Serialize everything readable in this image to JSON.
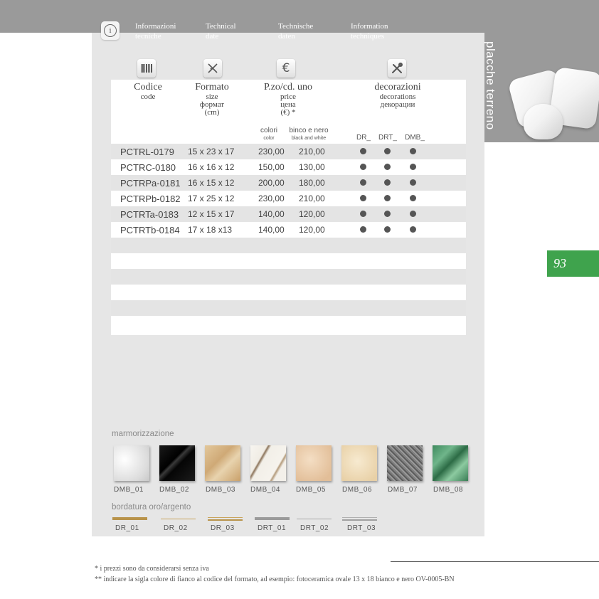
{
  "header": {
    "languages": [
      {
        "line1": "Informazioni",
        "line2": "tecniche"
      },
      {
        "line1": "Technical",
        "line2": "date"
      },
      {
        "line1": "Technische",
        "line2": "daten"
      },
      {
        "line1": "Information",
        "line2": "techniques"
      }
    ],
    "vertical_title": "placche terreno",
    "page_number": "93"
  },
  "icons": {
    "info": "info-icon",
    "barcode": "barcode-icon",
    "ruler": "ruler-pencil-icon",
    "euro": "euro-icon",
    "tools": "tools-icon"
  },
  "table": {
    "headers": {
      "code": {
        "main": "Codice",
        "sub": "code"
      },
      "size": {
        "main": "Formato",
        "sub": "size\nформат\n(cm)"
      },
      "price": {
        "main": "P.zo/cd. uno",
        "sub": "price\nцена\n(€) *"
      },
      "decorations": {
        "main": "decorazioni",
        "sub": "decorations\nдекорации"
      }
    },
    "subheaders": {
      "color": "colori",
      "color_en": "color",
      "bw": "binco e nero",
      "bw_en": "black and white",
      "dr": "DR_",
      "drt": "DRT_",
      "dmb": "DMB_"
    },
    "rows": [
      {
        "code": "PCTRL-0179",
        "size": "15 x 23 x 17",
        "color_price": "230,00",
        "bw_price": "210,00",
        "dr": true,
        "drt": true,
        "dmb": true
      },
      {
        "code": "PCTRC-0180",
        "size": "16 x 16 x 12",
        "color_price": "150,00",
        "bw_price": "130,00",
        "dr": true,
        "drt": true,
        "dmb": true
      },
      {
        "code": "PCTRPa-0181",
        "size": "16 x 15 x 12",
        "color_price": "200,00",
        "bw_price": "180,00",
        "dr": true,
        "drt": true,
        "dmb": true
      },
      {
        "code": "PCTRPb-0182",
        "size": "17 x 25 x 12",
        "color_price": "230,00",
        "bw_price": "210,00",
        "dr": true,
        "drt": true,
        "dmb": true
      },
      {
        "code": "PCTRTa-0183",
        "size": "12 x 15 x 17",
        "color_price": "140,00",
        "bw_price": "120,00",
        "dr": true,
        "drt": true,
        "dmb": true
      },
      {
        "code": "PCTRTb-0184",
        "size": "17 x 18 x13",
        "color_price": "140,00",
        "bw_price": "120,00",
        "dr": true,
        "drt": true,
        "dmb": true
      }
    ]
  },
  "marble": {
    "label": "marmorizzazione",
    "swatches": [
      {
        "name": "DMB_01",
        "color": "#ececec"
      },
      {
        "name": "DMB_02",
        "color": "#111111"
      },
      {
        "name": "DMB_03",
        "color": "#d8bc8e"
      },
      {
        "name": "DMB_04",
        "color": "#f2efe8"
      },
      {
        "name": "DMB_05",
        "color": "#ebcfb0"
      },
      {
        "name": "DMB_06",
        "color": "#efdfc0"
      },
      {
        "name": "DMB_07",
        "color": "#8a8a8a"
      },
      {
        "name": "DMB_08",
        "color": "#4f9a6c"
      }
    ]
  },
  "border": {
    "label": "bordatura oro/argento",
    "lines": [
      {
        "name": "DR_01",
        "color": "#b8934a",
        "style": "solid"
      },
      {
        "name": "DR_02",
        "color": "#c9a45c",
        "style": "thin"
      },
      {
        "name": "DR_03",
        "color": "#b8934a",
        "style": "double"
      },
      {
        "name": "DRT_01",
        "color": "#9a9a9a",
        "style": "solid"
      },
      {
        "name": "DRT_02",
        "color": "#a8a8a8",
        "style": "thin"
      },
      {
        "name": "DRT_03",
        "color": "#a0a0a0",
        "style": "double"
      }
    ]
  },
  "footnotes": [
    "* i prezzi sono da considerarsi senza iva",
    "** indicare la sigla colore di fianco al codice del formato, ad esempio: fotoceramica ovale 13 x 18 bianco e nero OV-0005-BN"
  ]
}
